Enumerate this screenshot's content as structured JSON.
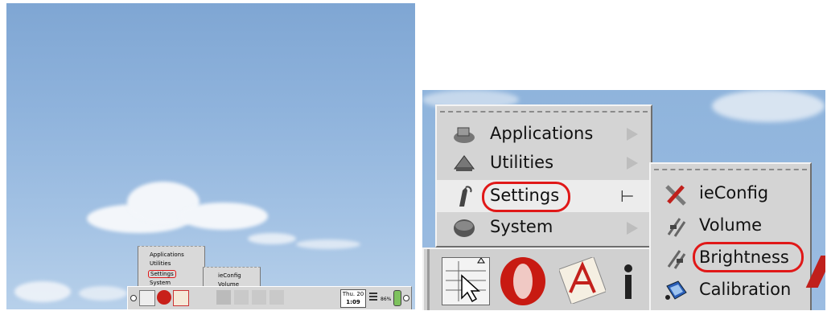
{
  "start_menu": {
    "items": [
      {
        "label": "Applications",
        "icon": "applications-icon"
      },
      {
        "label": "Utilities",
        "icon": "utilities-icon"
      },
      {
        "label": "Settings",
        "icon": "settings-icon",
        "highlighted": true
      },
      {
        "label": "System",
        "icon": "system-icon"
      }
    ]
  },
  "settings_submenu": {
    "items": [
      {
        "label": "ieConfig",
        "icon": "ieconfig-icon"
      },
      {
        "label": "Volume",
        "icon": "volume-icon"
      },
      {
        "label": "Brightness",
        "icon": "brightness-icon",
        "highlighted": true
      },
      {
        "label": "Calibration",
        "icon": "calibration-icon"
      }
    ]
  },
  "taskbar": {
    "clock_day": "Thu. 20",
    "clock_time": "1:09",
    "battery_percent": "86%"
  },
  "colors": {
    "highlight_circle": "#e01818",
    "menu_bg": "#d4d4d4",
    "sky": "#8fb3dc"
  }
}
